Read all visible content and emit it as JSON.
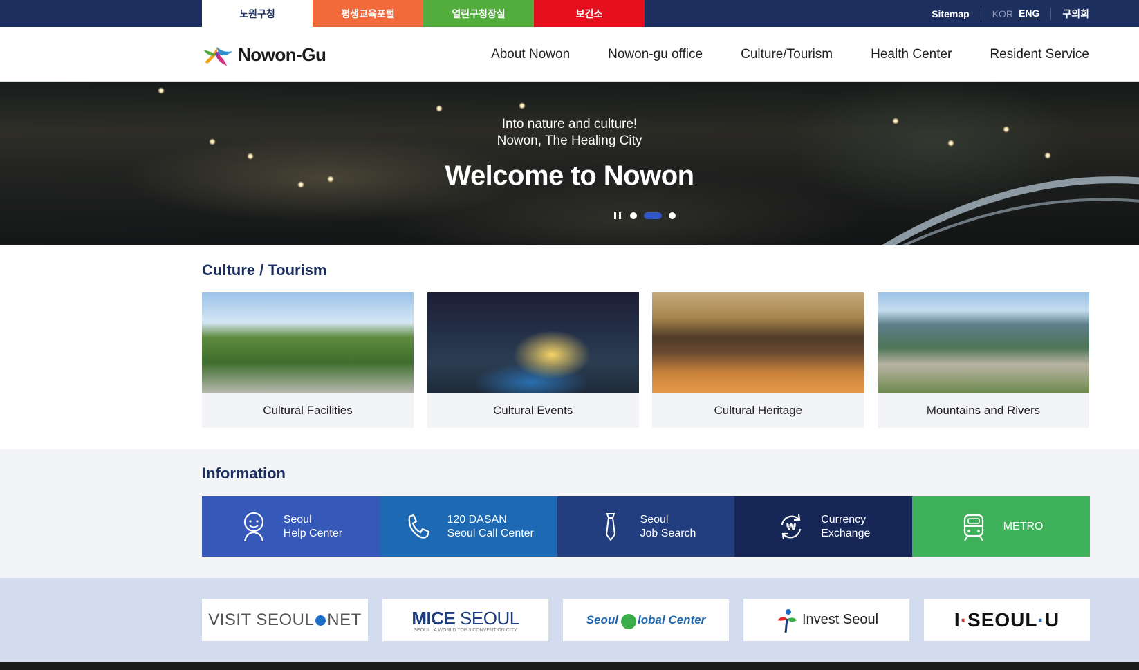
{
  "topbar": {
    "tabs": [
      "노원구청",
      "평생교육포털",
      "열린구청장실",
      "보건소"
    ],
    "sitemap": "Sitemap",
    "lang_kor": "KOR",
    "lang_eng": "ENG",
    "council": "구의회"
  },
  "header": {
    "logo_text": "Nowon-Gu",
    "nav": [
      "About Nowon",
      "Nowon-gu office",
      "Culture/Tourism",
      "Health Center",
      "Resident Service"
    ]
  },
  "hero": {
    "line1": "Into nature and culture!",
    "line2": "Nowon, The Healing City",
    "title": "Welcome to Nowon",
    "active_slide": 2,
    "slide_count": 3
  },
  "culture": {
    "title": "Culture / Tourism",
    "cards": [
      "Cultural Facilities",
      "Cultural Events",
      "Cultural Heritage",
      "Mountains and Rivers"
    ]
  },
  "information": {
    "title": "Information",
    "items": [
      {
        "line1": "Seoul",
        "line2": "Help Center",
        "icon": "help-center-icon"
      },
      {
        "line1": "120 DASAN",
        "line2": "Seoul Call Center",
        "icon": "phone-icon"
      },
      {
        "line1": "Seoul",
        "line2": "Job Search",
        "icon": "tie-icon"
      },
      {
        "line1": "Currency",
        "line2": "Exchange",
        "icon": "currency-exchange-icon"
      },
      {
        "line1": "METRO",
        "line2": "",
        "icon": "metro-train-icon"
      }
    ]
  },
  "banners": {
    "visit_a": "VISIT SEOUL",
    "visit_b": "NET",
    "mice_a": "MICE",
    "mice_b": " SEOUL",
    "mice_sub": "SEOUL : A WORLD TOP 3 CONVENTION CITY",
    "global_a": "Seoul",
    "global_b": "lobal Center",
    "invest": "Invest Seoul",
    "iseoul_i": "I",
    "iseoul_seoul": "SEOUL",
    "iseoul_u": "U"
  },
  "colors": {
    "topbar": "#1c2f5e",
    "tab_orange": "#f26a3a",
    "tab_green": "#52ad3c",
    "tab_red": "#e60f1e",
    "accent_blue": "#2f57c8",
    "metro_green": "#3eb15a"
  }
}
